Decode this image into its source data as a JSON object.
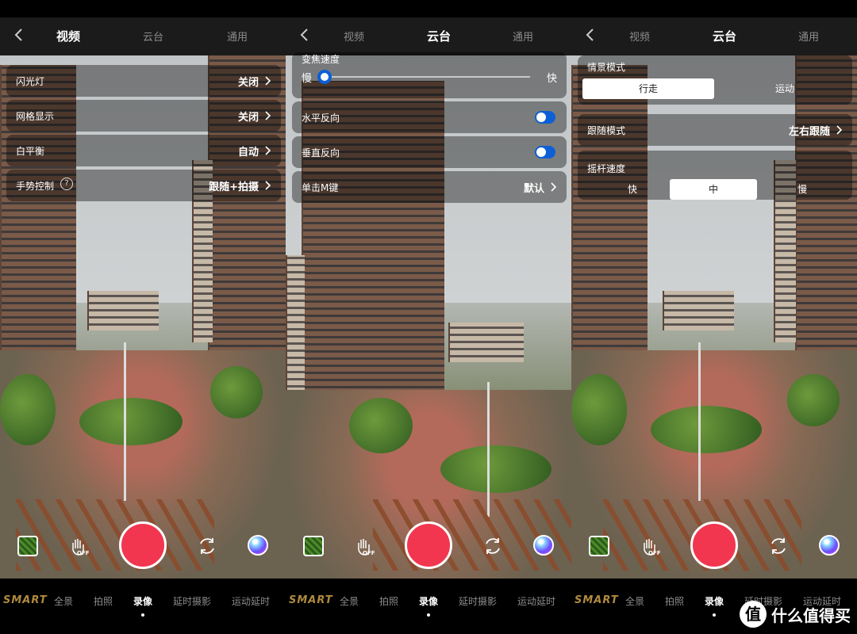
{
  "panel1": {
    "tabs": [
      "视频",
      "云台",
      "通用"
    ],
    "active_tab": 0,
    "rows": [
      {
        "label": "闪光灯",
        "value": "关闭"
      },
      {
        "label": "网格显示",
        "value": "关闭"
      },
      {
        "label": "白平衡",
        "value": "自动"
      },
      {
        "label": "手势控制",
        "value": "跟随+拍摄",
        "help": "?"
      }
    ]
  },
  "panel2": {
    "tabs": [
      "视频",
      "云台",
      "通用"
    ],
    "active_tab": 1,
    "zoom_speed": {
      "label": "变焦速度",
      "min_label": "慢",
      "max_label": "快",
      "value": 0.0
    },
    "toggles": [
      {
        "label": "水平反向",
        "on": true
      },
      {
        "label": "垂直反向",
        "on": true
      }
    ],
    "m_key": {
      "label": "单击M键",
      "value": "默认"
    }
  },
  "panel3": {
    "tabs": [
      "视频",
      "云台",
      "通用"
    ],
    "active_tab": 1,
    "scene_mode": {
      "label": "情景模式",
      "options": [
        "行走",
        "运动"
      ],
      "selected": "行走"
    },
    "follow_mode": {
      "label": "跟随模式",
      "value": "左右跟随"
    },
    "joystick_speed": {
      "label": "摇杆速度",
      "options": [
        "快",
        "中",
        "慢"
      ],
      "selected": "中"
    }
  },
  "modes": [
    "SMART",
    "全景",
    "拍照",
    "录像",
    "延时摄影",
    "运动延时"
  ],
  "active_mode": "录像",
  "gesture_badge": "OFF",
  "watermark": {
    "logo": "值",
    "text": "什么值得买"
  },
  "colors": {
    "shutter": "#f2364f",
    "accent": "#0d5fd6",
    "smart": "#b08a3e"
  }
}
